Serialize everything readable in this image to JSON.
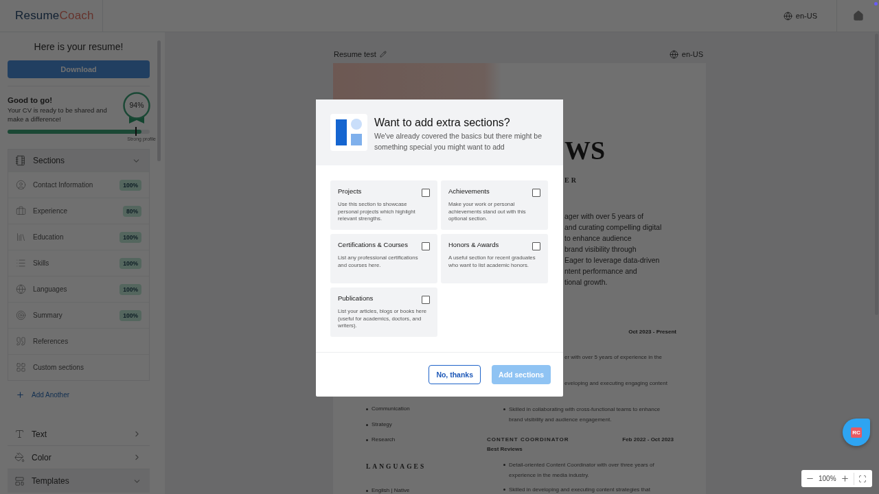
{
  "header": {
    "logo_parts": [
      "Resume",
      "Coach"
    ],
    "locale": "en-US"
  },
  "sidebar": {
    "title": "Here is your resume!",
    "download": "Download",
    "score": {
      "heading": "Good to go!",
      "message": "Your CV is ready to be shared and make a difference!",
      "percent": "94%",
      "level": 0.94,
      "marker_label": "Strong profile"
    },
    "sections": {
      "title": "Sections",
      "expanded": true,
      "items": [
        {
          "kind": "contact",
          "label": "Contact Information",
          "badge": "100%"
        },
        {
          "kind": "experience",
          "label": "Experience",
          "badge": "80%"
        },
        {
          "kind": "education",
          "label": "Education",
          "badge": "100%"
        },
        {
          "kind": "skills",
          "label": "Skills",
          "badge": "100%"
        },
        {
          "kind": "languages",
          "label": "Languages",
          "badge": "100%"
        },
        {
          "kind": "summary",
          "label": "Summary",
          "badge": "100%"
        },
        {
          "kind": "references",
          "label": "References"
        },
        {
          "kind": "custom",
          "label": "Custom sections"
        }
      ]
    },
    "add_another": "Add Another",
    "panels": [
      {
        "kind": "text",
        "label": "Text",
        "expanded": false
      },
      {
        "kind": "color",
        "label": "Color",
        "expanded": false
      },
      {
        "kind": "templates",
        "label": "Templates",
        "expanded": true
      }
    ]
  },
  "document": {
    "title": "Resume test",
    "locale": "en-US",
    "resume": {
      "name_fragment": "WS",
      "role_fragment": "ER",
      "summary_fragments": [
        "ager with over 5 years of",
        "and curating compelling digital",
        "to enhance audience",
        "brand visibility through",
        "Eager to leverage data-driven",
        "ntent performance and",
        "tional growth."
      ],
      "job_dates": "Oct 2023 - Present",
      "job_fragments": [
        "er with over 5 years of experience in the",
        "eveloping and executing engaging content"
      ],
      "skills": [
        "Communication",
        "Strategy",
        "Research"
      ],
      "languages_heading": "LANGUAGES",
      "languages": [
        "English | Native"
      ],
      "continued_bullets": [
        "Skilled in collaborating with cross-functional teams to enhance brand visibility and audience engagement."
      ],
      "job": {
        "title": "CONTENT COORDINATOR",
        "dates": "Feb 2022 - Oct 2023",
        "company": "Best Reviews",
        "bullets": [
          "Detail-oriented Content Coordinator with over three years of experience in the media industry.",
          "Skilled in developing and executing content strategies that"
        ]
      }
    }
  },
  "assistant_badge": "RC",
  "zoom": {
    "value": "100%"
  },
  "dialog": {
    "title": "Want to add extra sections?",
    "subtitle": "We've already covered the basics but there might be something special you might want to add",
    "options": [
      {
        "title": "Projects",
        "description": "Use this section to showcase personal projects which highlight relevant strengths.",
        "checked": false
      },
      {
        "title": "Achievements",
        "description": "Make your work or personal achievements stand out with this optional section.",
        "checked": false
      },
      {
        "title": "Certifications & Courses",
        "description": "List any professional certifications and courses here.",
        "checked": false
      },
      {
        "title": "Honors & Awards",
        "description": "A useful section for recent graduates who want to list academic honors.",
        "checked": false
      },
      {
        "title": "Publications",
        "description": "List your articles, blogs or books here (useful for academics, doctors, and writers).",
        "checked": false
      }
    ],
    "buttons": [
      {
        "kind": "secondary",
        "label": "No, thanks",
        "disabled": false
      },
      {
        "kind": "primary",
        "label": "Add sections",
        "disabled": true
      }
    ]
  }
}
